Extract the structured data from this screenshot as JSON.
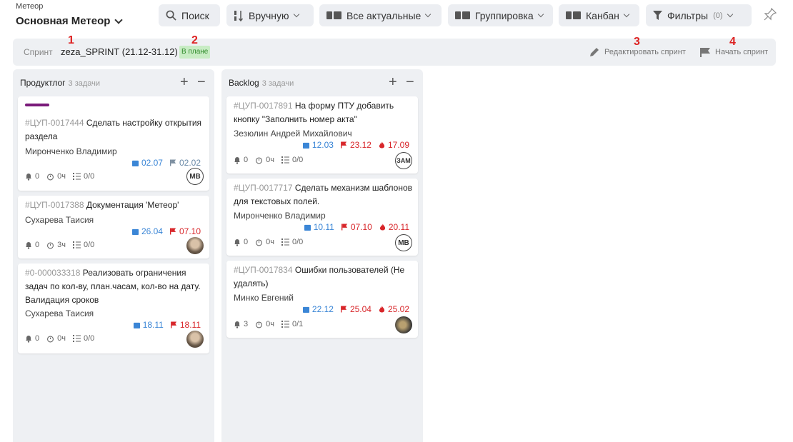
{
  "header": {
    "project_caption": "Метеор",
    "project_name": "Основная Метеор",
    "search_label": "Поиск",
    "sort_label": "Вручную",
    "filter_view_label": "Все актуальные",
    "group_label": "Группировка",
    "view_label": "Канбан",
    "filters_label": "Фильтры",
    "filters_count": "(0)"
  },
  "sprint": {
    "caption": "Спринт",
    "name": "zeza_SPRINT (21.12-31.12)",
    "status": "В плане",
    "edit_label": "Редактировать спринт",
    "start_label": "Начать спринт"
  },
  "markers": [
    "1",
    "2",
    "3",
    "4"
  ],
  "columns": [
    {
      "title": "Продуктлог",
      "count": "3 задачи",
      "cards": [
        {
          "id": "#ЦУП-0017444",
          "title": "Сделать настройку открытия раздела",
          "assignee": "Мирoнченко Владимир",
          "date_start": "02.07",
          "date_flag": "02.02",
          "bell": "0",
          "hours": "0ч",
          "subtasks": "0/0",
          "avatar": "МВ"
        },
        {
          "id": "#ЦУП-0017388",
          "title": "Документация 'Метеор'",
          "assignee": "Сухарева Таисия",
          "date_start": "26.04",
          "date_flag": "07.10",
          "bell": "0",
          "hours": "3ч",
          "subtasks": "0/0"
        },
        {
          "id": "#0-000033318",
          "title": "Реализовать ограничения задач по кол-ву, план.часам, кол-во на дату. Валидация сроков",
          "assignee": "Сухарева Таисия",
          "date_start": "18.11",
          "date_flag": "18.11",
          "bell": "0",
          "hours": "0ч",
          "subtasks": "0/0"
        }
      ]
    },
    {
      "title": "Backlog",
      "count": "3 задачи",
      "cards": [
        {
          "id": "#ЦУП-0017891",
          "title": "На форму ПТУ добавить кнопку \"Заполнить номер акта\"",
          "assignee": "Зезюлин Андрей Михайлович",
          "date_start": "12.03",
          "date_flag": "23.12",
          "date_fire": "17.09",
          "bell": "0",
          "hours": "0ч",
          "subtasks": "0/0",
          "avatar": "ЗАМ"
        },
        {
          "id": "#ЦУП-0017717",
          "title": "Сделать механизм шаблонов для текстовых полей.",
          "assignee": "Мирoнченко Владимир",
          "date_start": "10.11",
          "date_flag": "07.10",
          "date_fire": "20.11",
          "bell": "0",
          "hours": "0ч",
          "subtasks": "0/0",
          "avatar": "МВ"
        },
        {
          "id": "#ЦУП-0017834",
          "title": "Ошибки пользователей (Не удалять)",
          "assignee": "Минко Евгений",
          "date_start": "22.12",
          "date_flag": "25.04",
          "date_fire": "25.02",
          "bell": "3",
          "hours": "0ч",
          "subtasks": "0/1"
        }
      ]
    }
  ],
  "colors": {
    "accent_blue": "#3b86d6",
    "accent_red": "#d8262a",
    "status_green": "#c8ecc4",
    "priority_purple": "#7a1a7a"
  }
}
